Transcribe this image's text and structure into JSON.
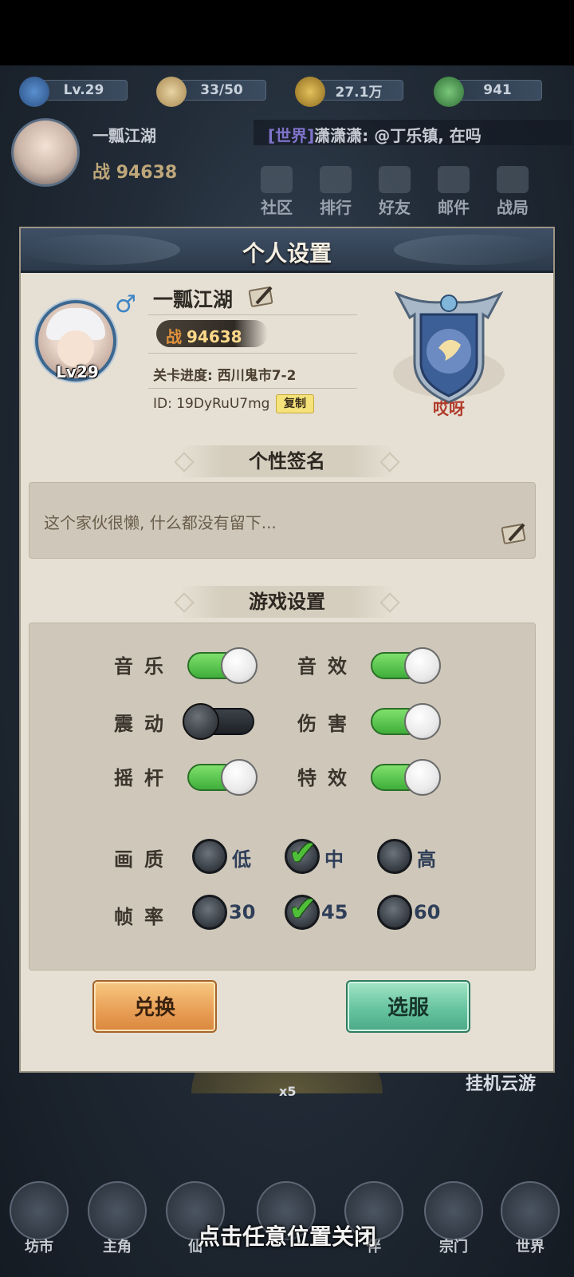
{
  "hud": {
    "level": "Lv.29",
    "stamina": "33/50",
    "coins": "27.1万",
    "jade": "941",
    "player_name": "一瓢江湖",
    "power_prefix": "战",
    "power_value": "94638",
    "chat_channel": "[世界]",
    "chat_message": "潇潇潇: @丁乐镇, 在吗",
    "menu": [
      "社区",
      "排行",
      "好友",
      "邮件",
      "战局"
    ],
    "idle_label": "挂机云游",
    "reward_count": "x5"
  },
  "bottom_nav": [
    "坊市",
    "主角",
    "仙",
    "",
    "伴",
    "宗门",
    "世界"
  ],
  "dialog": {
    "title": "个人设置",
    "avatar_level": "Lv29",
    "gender_symbol": "♂",
    "name": "一瓢江湖",
    "power_prefix": "战",
    "power_value": "94638",
    "stage_progress": "关卡进度: 西川鬼市7-2",
    "player_id": "ID: 19DyRuU7mg",
    "copy_label": "复制",
    "crest_label": "哎呀",
    "signature_title": "个性签名",
    "signature_text": "这个家伙很懒, 什么都没有留下...",
    "game_settings_title": "游戏设置",
    "toggles": [
      {
        "label": "音乐",
        "on": true
      },
      {
        "label": "音效",
        "on": true
      },
      {
        "label": "震动",
        "on": false
      },
      {
        "label": "伤害",
        "on": true
      },
      {
        "label": "摇杆",
        "on": true
      },
      {
        "label": "特效",
        "on": true
      }
    ],
    "quality": {
      "label": "画质",
      "options": [
        "低",
        "中",
        "高"
      ],
      "selected": "中"
    },
    "framerate": {
      "label": "帧率",
      "options": [
        "30",
        "45",
        "60"
      ],
      "selected": "45"
    },
    "exchange_button": "兑换",
    "server_button": "选服"
  },
  "close_hint": "点击任意位置关闭",
  "colors": {
    "toggle_on": "#4fbf3a",
    "dialog_bg": "#e6e0d4",
    "header_bg": "#2c394a",
    "exchange_btn": "#eaa158",
    "server_btn": "#67c4a0"
  }
}
